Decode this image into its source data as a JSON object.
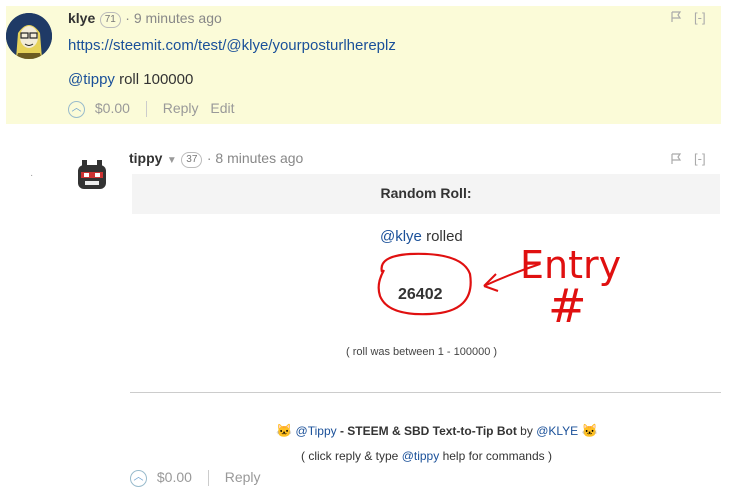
{
  "comment1": {
    "author": "klye",
    "reputation": "71",
    "time": "· 9 minutes ago",
    "link": "https://steemit.com/test/@klye/yourposturlhereplz",
    "mention": "@tippy",
    "command": " roll 100000",
    "payout": "$0.00",
    "reply_label": "Reply",
    "edit_label": "Edit",
    "collapse_label": "[-]"
  },
  "comment2": {
    "author": "tippy",
    "reputation": "37",
    "time": "· 8 minutes ago",
    "collapse_label": "[-]",
    "heading": "Random Roll:",
    "mention": "@klye",
    "rolled_text": " rolled",
    "roll_value": "26402",
    "range_note": "( roll was between 1 - 100000 )",
    "bot_name": "@Tippy",
    "bot_desc": " - STEEM & SBD Text-to-Tip Bot",
    "by_text": " by ",
    "bot_owner": "@KLYE",
    "help_prefix": "( click reply & type ",
    "help_mention": "@tippy",
    "help_suffix": " help for commands )",
    "payout": "$0.00",
    "reply_label": "Reply"
  },
  "annotation": {
    "text_line1": "Entry",
    "text_line2": "#",
    "color": "#e01010"
  },
  "colors": {
    "highlight_bg": "#fbfbd8",
    "link": "#1a5099",
    "annotation_red": "#e01010"
  }
}
